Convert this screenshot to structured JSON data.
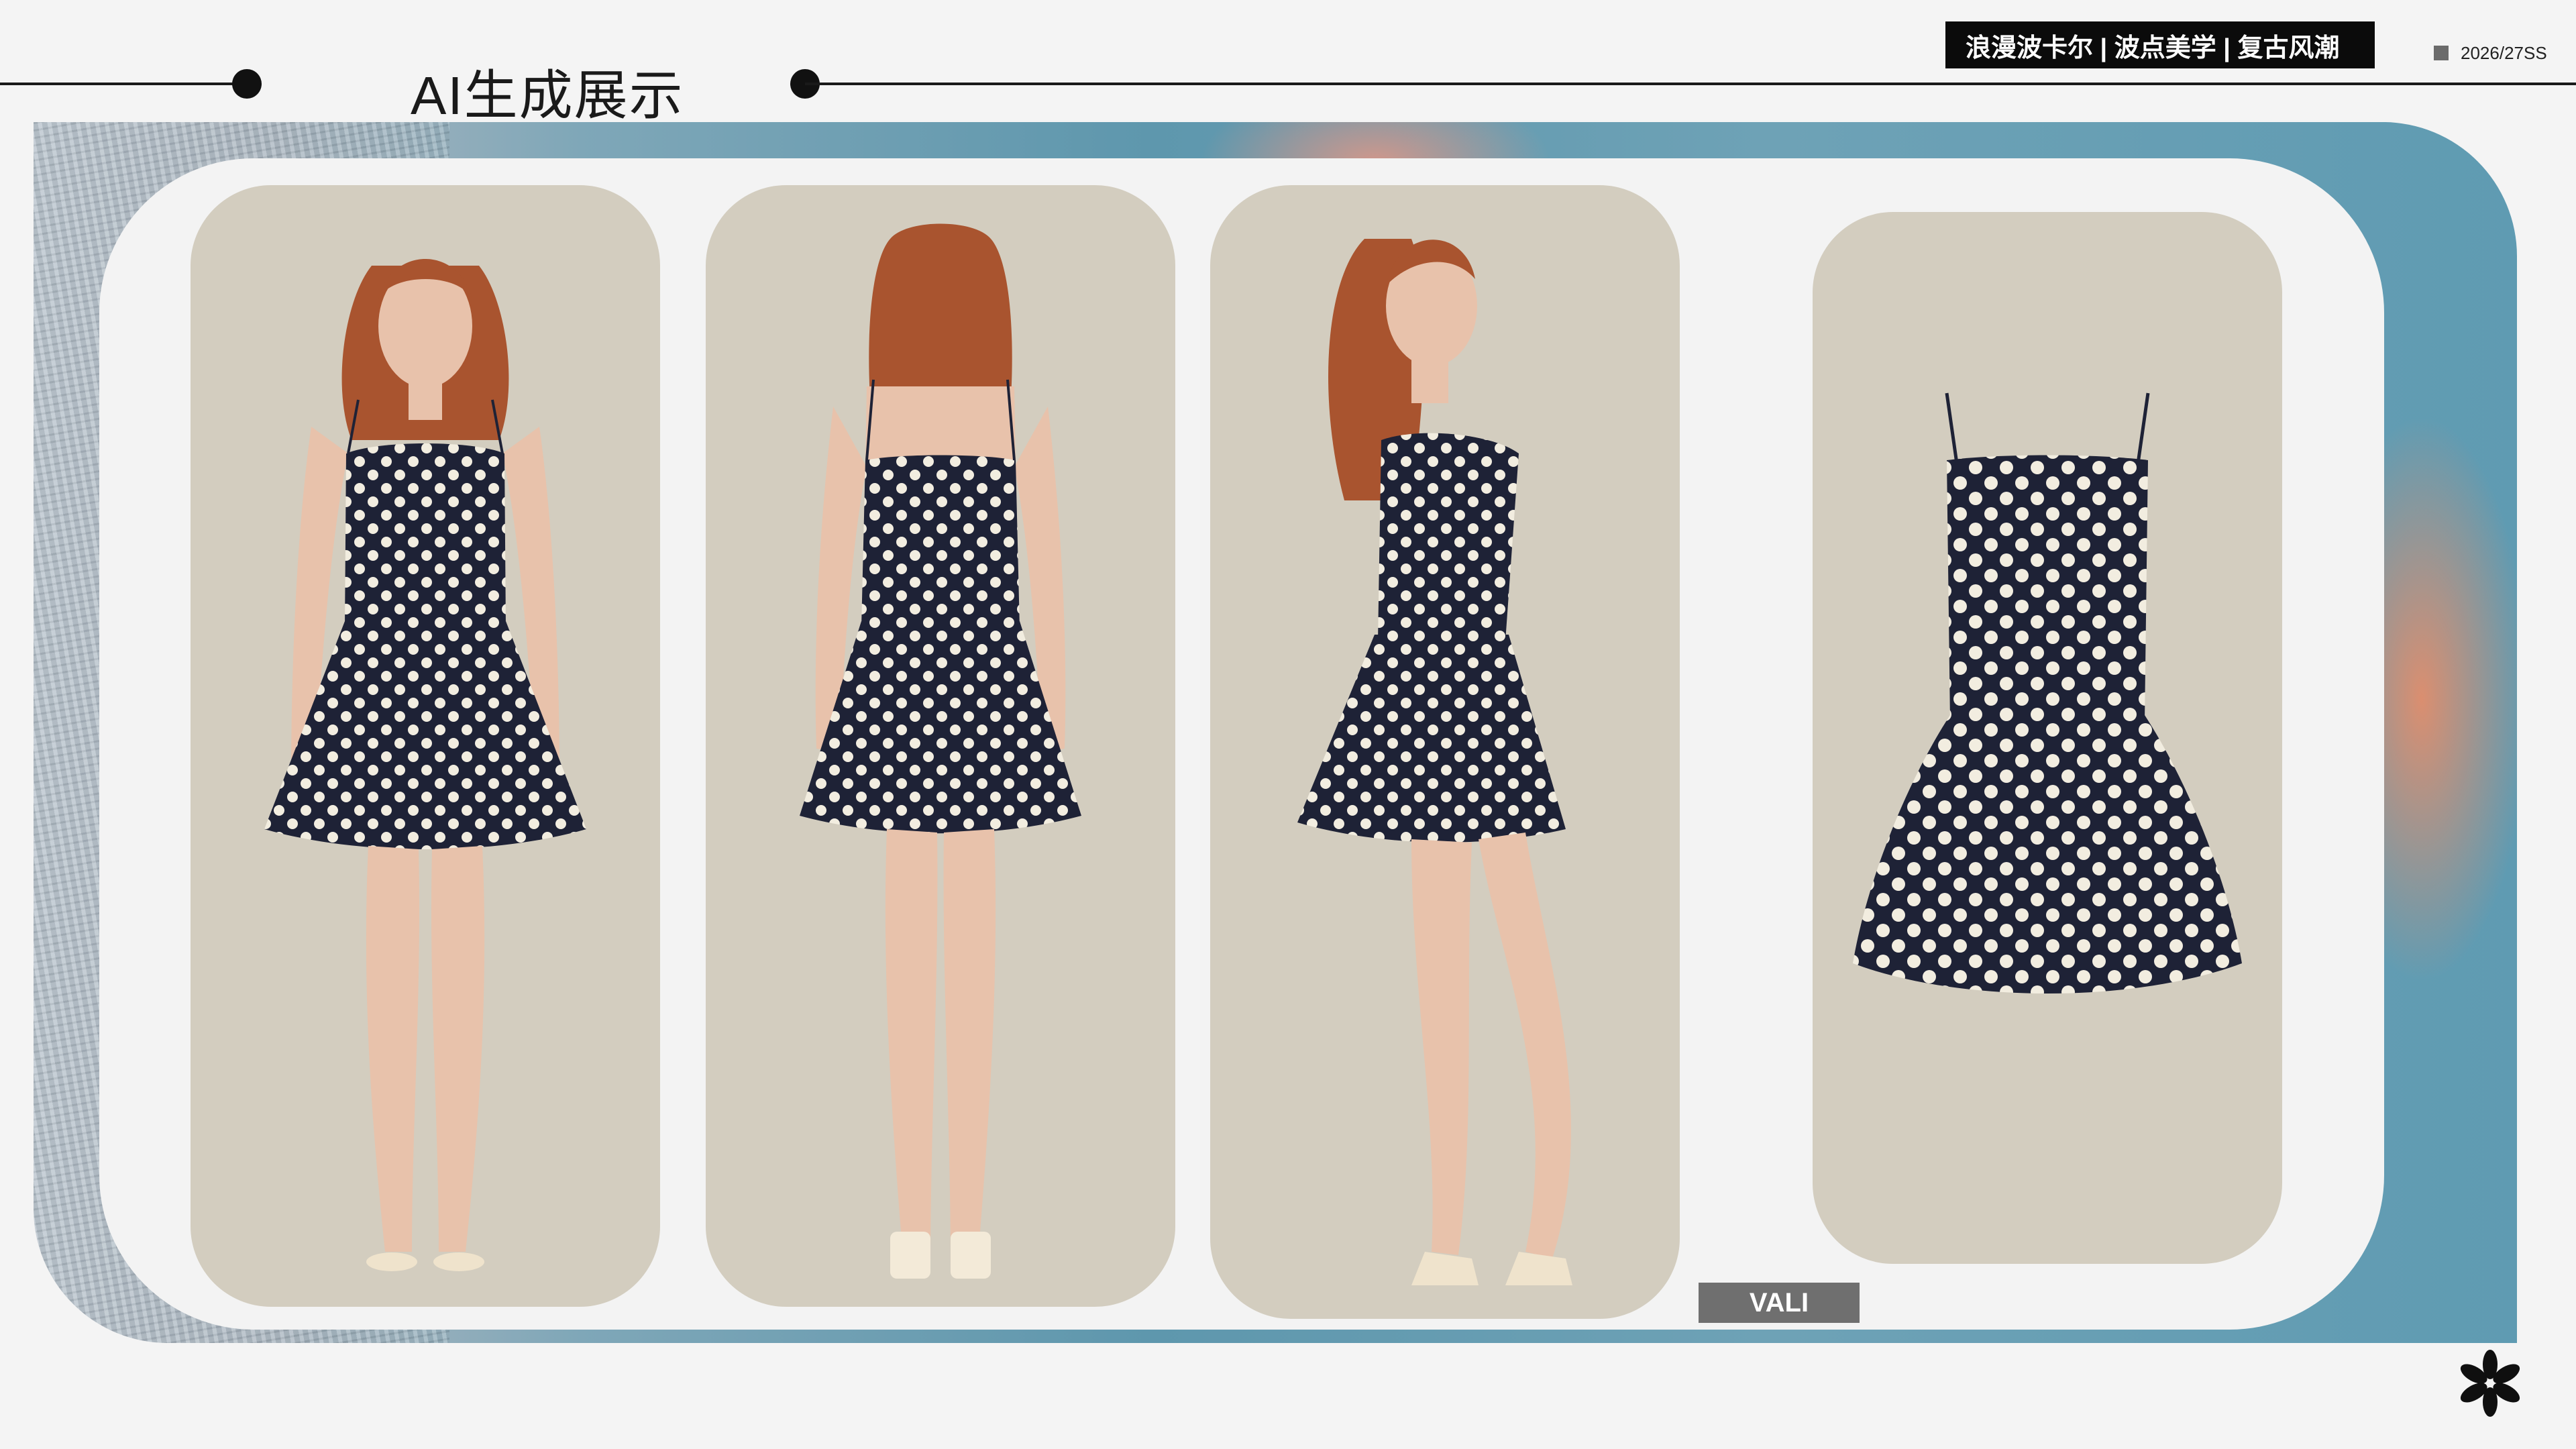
{
  "header": {
    "title": "AI生成展示",
    "tagline": "浪漫波卡尔 | 波点美学 | 复古风潮",
    "season": "2026/27SS"
  },
  "gallery": {
    "images": [
      {
        "id": "front-view",
        "icon": "model-front-illustration"
      },
      {
        "id": "back-view",
        "icon": "model-back-illustration"
      },
      {
        "id": "side-view",
        "icon": "model-side-illustration"
      },
      {
        "id": "flat-lay",
        "icon": "dress-flatlay-illustration"
      }
    ],
    "badge": "VALI"
  },
  "colors": {
    "card_bg": "#d3cdbf",
    "dress": "#1e2236",
    "dots": "#f2ede0",
    "skin": "#e8c2ab",
    "hair": "#a9542f",
    "accent_teal": "#5e97ad"
  }
}
